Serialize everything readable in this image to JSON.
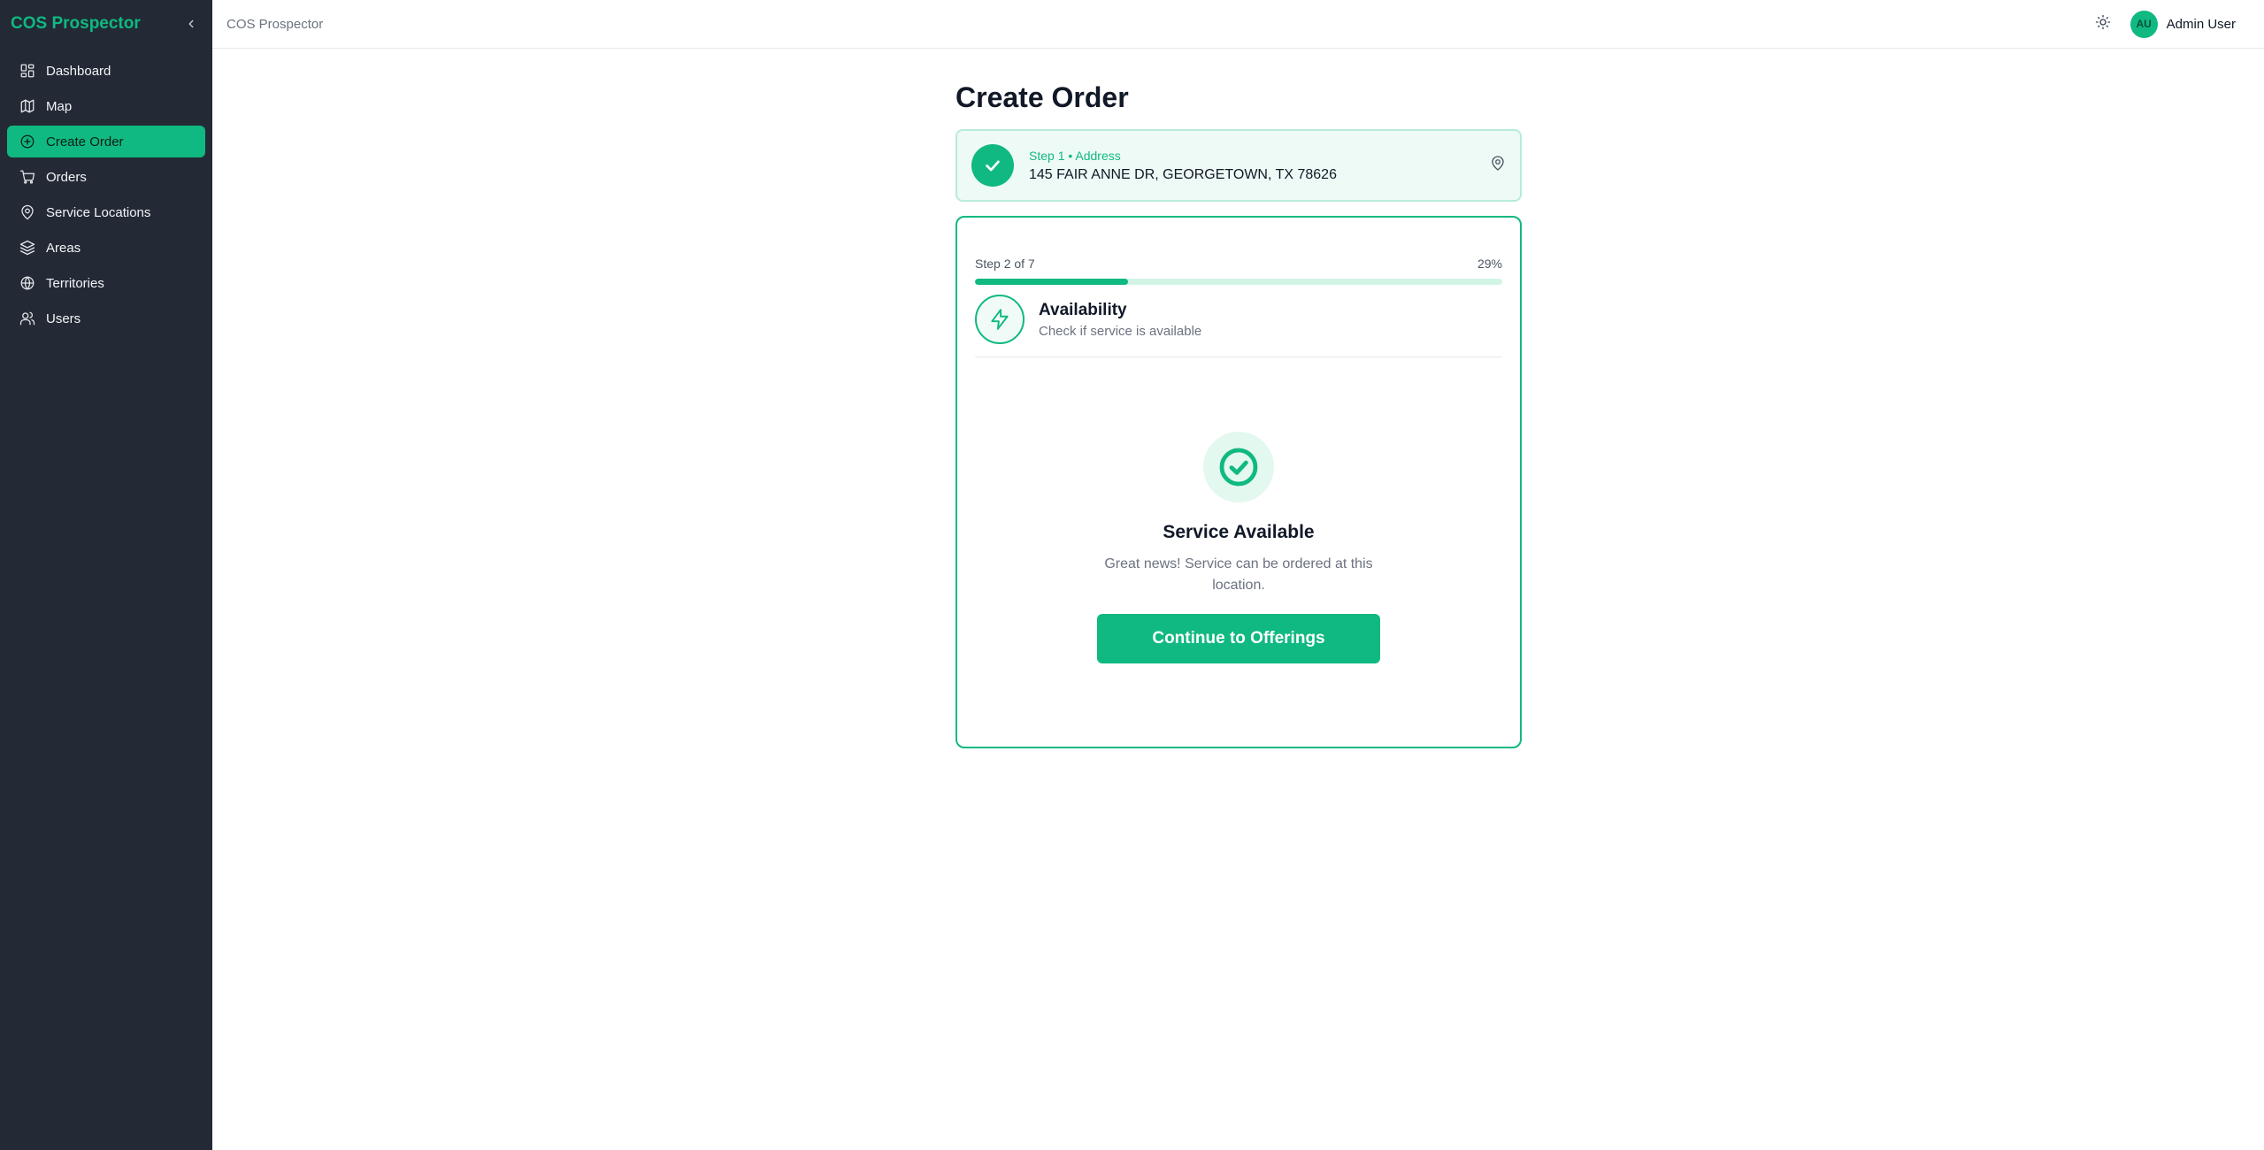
{
  "app": {
    "name": "COS Prospector"
  },
  "sidebar": {
    "items": [
      {
        "label": "Dashboard",
        "icon": "dashboard-icon",
        "active": false
      },
      {
        "label": "Map",
        "icon": "map-icon",
        "active": false
      },
      {
        "label": "Create Order",
        "icon": "plus-circle-icon",
        "active": true
      },
      {
        "label": "Orders",
        "icon": "cart-icon",
        "active": false
      },
      {
        "label": "Service Locations",
        "icon": "location-pin-icon",
        "active": false
      },
      {
        "label": "Areas",
        "icon": "layers-icon",
        "active": false
      },
      {
        "label": "Territories",
        "icon": "globe-icon",
        "active": false
      },
      {
        "label": "Users",
        "icon": "users-icon",
        "active": false
      }
    ]
  },
  "header": {
    "breadcrumb": "COS Prospector",
    "user": {
      "initials": "AU",
      "name": "Admin User"
    }
  },
  "page": {
    "title": "Create Order",
    "completed_step": {
      "label": "Step 1 • Address",
      "address": "145 FAIR ANNE DR, GEORGETOWN, TX 78626"
    },
    "progress": {
      "step_text": "Step 2 of 7",
      "percent_text": "29%",
      "fraction": 0.29
    },
    "current_step": {
      "title": "Availability",
      "subtitle": "Check if service is available"
    },
    "result": {
      "title": "Service Available",
      "message": "Great news! Service can be ordered at this location.",
      "button_label": "Continue to Offerings"
    }
  },
  "colors": {
    "accent": "#10b981",
    "sidebar_bg": "#232a35"
  }
}
